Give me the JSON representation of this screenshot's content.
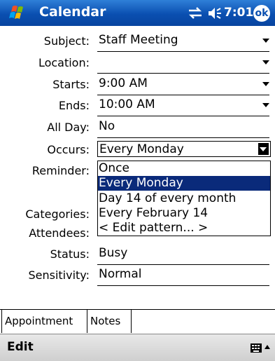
{
  "titlebar": {
    "app_title": "Calendar",
    "time": "7:01",
    "ok_label": "ok"
  },
  "form": {
    "subject": {
      "label": "Subject:",
      "value": "Staff Meeting"
    },
    "location": {
      "label": "Location:",
      "value": ""
    },
    "starts": {
      "label": "Starts:",
      "value": "9:00 AM"
    },
    "ends": {
      "label": "Ends:",
      "value": "10:00 AM"
    },
    "allday": {
      "label": "All Day:",
      "value": "No"
    },
    "occurs": {
      "label": "Occurs:",
      "value": "Every Monday"
    },
    "reminder": {
      "label": "Reminder:"
    },
    "categories": {
      "label": "Categories:"
    },
    "attendees": {
      "label": "Attendees:"
    },
    "status": {
      "label": "Status:",
      "value": "Busy"
    },
    "sensitivity": {
      "label": "Sensitivity:",
      "value": "Normal"
    }
  },
  "occurs_options": [
    "Once",
    "Every Monday",
    "Day 14 of every month",
    "Every February 14",
    "< Edit pattern... >"
  ],
  "tabs": [
    "Appointment",
    "Notes"
  ],
  "menubar": {
    "edit": "Edit"
  },
  "colors": {
    "titlebar": "#0a4fb0",
    "selection": "#0a2a7a"
  }
}
